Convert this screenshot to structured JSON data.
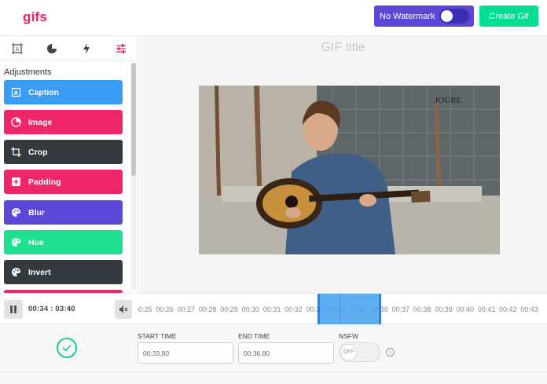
{
  "header": {
    "logo": "gifs",
    "watermark_label": "No Watermark",
    "create_label": "Create Gif"
  },
  "sidebar": {
    "tabs": [
      "frame-icon",
      "pie-icon",
      "bolt-icon",
      "sliders-icon"
    ],
    "active_tab": "sliders-icon",
    "section_label": "Adjustments",
    "items": [
      {
        "label": "Caption",
        "icon": "caption-icon",
        "color": "#3a9cf5"
      },
      {
        "label": "Image",
        "icon": "image-icon",
        "color": "#f0266a"
      },
      {
        "label": "Crop",
        "icon": "crop-icon",
        "color": "#343a40"
      },
      {
        "label": "Padding",
        "icon": "padding-icon",
        "color": "#f0266a"
      },
      {
        "label": "Blur",
        "icon": "palette-icon",
        "color": "#5b48d6"
      },
      {
        "label": "Hue",
        "icon": "palette-icon",
        "color": "#1ee090"
      },
      {
        "label": "Invert",
        "icon": "palette-icon",
        "color": "#343a40"
      }
    ]
  },
  "canvas": {
    "title_placeholder": "GIF title",
    "video_caption_text": "JOURE"
  },
  "timeline": {
    "current_time": "00:34",
    "separator": ":",
    "total_time": "03:40",
    "ticks": [
      "00:25",
      "00:26",
      "00:27",
      "00:28",
      "00:29",
      "00:30",
      "00:31",
      "00:32",
      "00:33",
      "00:34",
      "00:35",
      "00:36",
      "00:37",
      "00:38",
      "00:39",
      "00:40",
      "00:41",
      "00:42",
      "00:43"
    ]
  },
  "settings": {
    "start_label": "START TIME",
    "start_value": "00:33.80",
    "end_label": "END TIME",
    "end_value": "00:36.80",
    "nsfw_label": "NSFW",
    "nsfw_value": "OFF",
    "info_glyph": "i"
  }
}
